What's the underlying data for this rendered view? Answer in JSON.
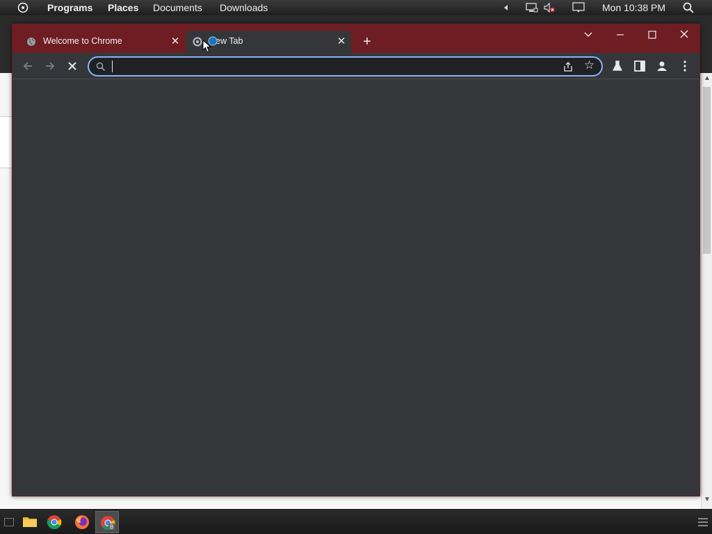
{
  "topbar": {
    "menus": [
      "Programs",
      "Places",
      "Documents",
      "Downloads"
    ],
    "clock": "Mon 10:38 PM"
  },
  "browser": {
    "tabs": [
      {
        "title": "Welcome to Chrome",
        "icon": "globe-icon",
        "active": false
      },
      {
        "title": "New Tab",
        "icon": "loading-icon",
        "active": true
      }
    ],
    "omnibox": {
      "value": "",
      "placeholder": ""
    },
    "colors": {
      "frame": "#6e1d22",
      "toolbar": "#35363a",
      "focus_ring": "#8ab4f8"
    }
  },
  "taskbar": {
    "apps": [
      "file-manager-icon",
      "chrome-icon",
      "firefox-icon",
      "chrome-beta-icon"
    ],
    "active_app": "chrome-beta-icon"
  }
}
